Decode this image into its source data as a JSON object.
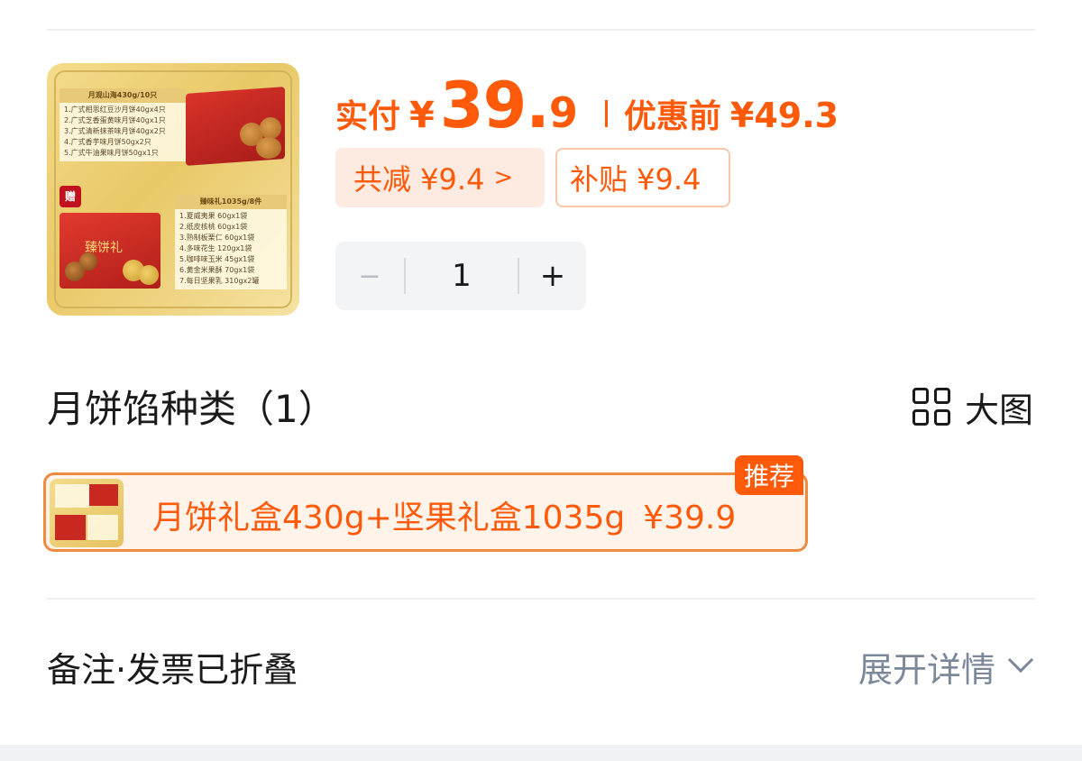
{
  "product": {
    "image_alt": "月饼礼盒430g+坚果礼盒1035g",
    "image_list1_title": "月观山海430g/10只",
    "image_list1_items": [
      "1.广式相思红豆沙月饼40gx4只",
      "2.广式芝香蛋黄味月饼40gx1只",
      "3.广式清新抹茶味月饼40gx2只",
      "4.广式香芋味月饼50gx2只",
      "5.广式牛油果味月饼50gx1只"
    ],
    "image_list2_title": "臻味礼1035g/8件",
    "image_list2_items": [
      "1.夏威夷果 60gx1袋",
      "2.纸皮核桃 60gx1袋",
      "3.熟制板栗仁 60gx1袋",
      "4.多味花生 120gx1袋",
      "5.咖啡味玉米 45gx1袋",
      "6.黄金米果酥 70gx1袋",
      "7.每日坚果乳 310gx2罐"
    ],
    "image_box_label": "臻饼礼",
    "image_gift_badge": "赠"
  },
  "price": {
    "paid_label": "实付",
    "currency": "¥",
    "paid_int": "39.",
    "paid_dec": "9",
    "original_label": "优惠前",
    "original_value": "¥49.3"
  },
  "badges": {
    "discount": "共减 ¥9.4",
    "discount_chevron": ">",
    "subsidy": "补贴 ¥9.4"
  },
  "stepper": {
    "minus": "−",
    "value": "1",
    "plus": "+"
  },
  "section": {
    "title": "月饼馅种类（1）",
    "big_view": "大图"
  },
  "option": {
    "label": "月饼礼盒430g+坚果礼盒1035g",
    "price": "¥39.9",
    "badge": "推荐"
  },
  "notes": {
    "label": "备注·发票已折叠",
    "expand": "展开详情"
  },
  "colors": {
    "accent": "#ff5a0a",
    "muted": "#7c8799",
    "discount_bg": "#fdeae0",
    "option_bg": "#fff3ea"
  }
}
